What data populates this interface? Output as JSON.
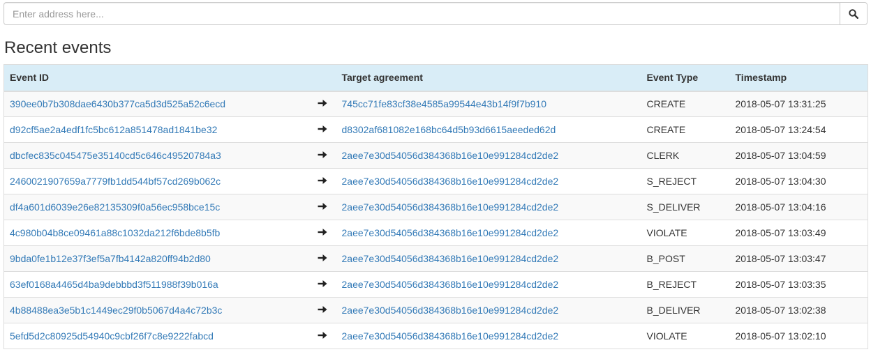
{
  "search": {
    "placeholder": "Enter address here...",
    "button_icon": "magnifier-icon"
  },
  "title": "Recent events",
  "table": {
    "headers": {
      "event_id": "Event ID",
      "target": "Target agreement",
      "type": "Event Type",
      "timestamp": "Timestamp"
    },
    "colors": {
      "header_bg": "#d9edf7",
      "link": "#337ab7",
      "stripe": "#f9f9f9"
    },
    "arrow_icon": "arrow-right-icon",
    "rows": [
      {
        "event_id": "390ee0b7b308dae6430b377ca5d3d525a52c6ecd",
        "target": "745cc71fe83cf38e4585a99544e43b14f9f7b910",
        "type": "CREATE",
        "timestamp": "2018-05-07 13:31:25"
      },
      {
        "event_id": "d92cf5ae2a4edf1fc5bc612a851478ad1841be32",
        "target": "d8302af681082e168bc64d5b93d6615aeeded62d",
        "type": "CREATE",
        "timestamp": "2018-05-07 13:24:54"
      },
      {
        "event_id": "dbcfec835c045475e35140cd5c646c49520784a3",
        "target": "2aee7e30d54056d384368b16e10e991284cd2de2",
        "type": "CLERK",
        "timestamp": "2018-05-07 13:04:59"
      },
      {
        "event_id": "2460021907659a7779fb1dd544bf57cd269b062c",
        "target": "2aee7e30d54056d384368b16e10e991284cd2de2",
        "type": "S_REJECT",
        "timestamp": "2018-05-07 13:04:30"
      },
      {
        "event_id": "df4a601d6039e26e82135309f0a56ec958bce15c",
        "target": "2aee7e30d54056d384368b16e10e991284cd2de2",
        "type": "S_DELIVER",
        "timestamp": "2018-05-07 13:04:16"
      },
      {
        "event_id": "4c980b04b8ce09461a88c1032da212f6bde8b5fb",
        "target": "2aee7e30d54056d384368b16e10e991284cd2de2",
        "type": "VIOLATE",
        "timestamp": "2018-05-07 13:03:49"
      },
      {
        "event_id": "9bda0fe1b12e37f3ef5a7fb4142a820ff94b2d80",
        "target": "2aee7e30d54056d384368b16e10e991284cd2de2",
        "type": "B_POST",
        "timestamp": "2018-05-07 13:03:47"
      },
      {
        "event_id": "63ef0168a4465d4ba9debbbd3f511988f39b016a",
        "target": "2aee7e30d54056d384368b16e10e991284cd2de2",
        "type": "B_REJECT",
        "timestamp": "2018-05-07 13:03:35"
      },
      {
        "event_id": "4b88488ea3e5b1c1449ec29f0b5067d4a4c72b3c",
        "target": "2aee7e30d54056d384368b16e10e991284cd2de2",
        "type": "B_DELIVER",
        "timestamp": "2018-05-07 13:02:38"
      },
      {
        "event_id": "5efd5d2c80925d54940c9cbf26f7c8e9222fabcd",
        "target": "2aee7e30d54056d384368b16e10e991284cd2de2",
        "type": "VIOLATE",
        "timestamp": "2018-05-07 13:02:10"
      }
    ]
  }
}
